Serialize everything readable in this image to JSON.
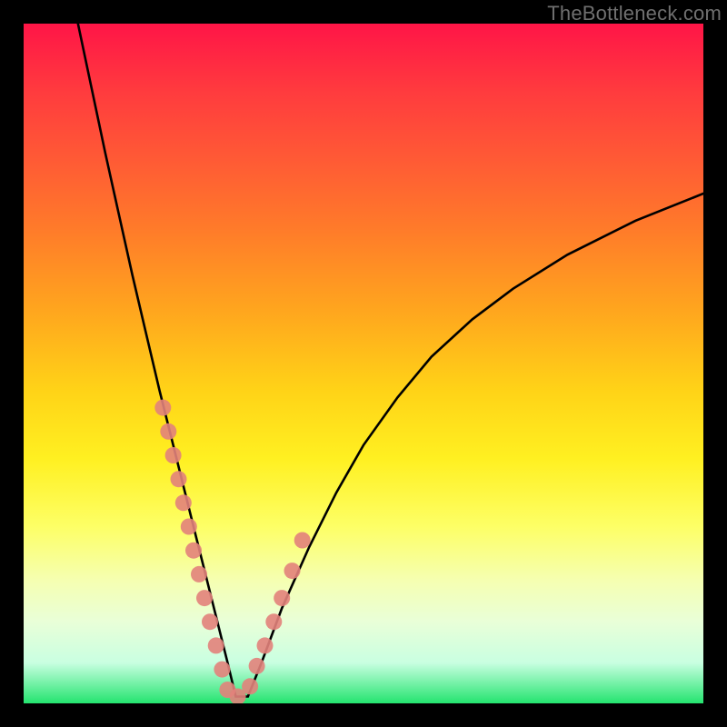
{
  "watermark": "TheBottleneck.com",
  "chart_data": {
    "type": "line",
    "title": "",
    "xlabel": "",
    "ylabel": "",
    "xlim": [
      0,
      100
    ],
    "ylim": [
      0,
      100
    ],
    "series": [
      {
        "name": "bottleneck-curve",
        "x": [
          8,
          10,
          12,
          14,
          16,
          18,
          20,
          22,
          24,
          25.5,
          27,
          28.5,
          30,
          31.2,
          33,
          35,
          38,
          42,
          46,
          50,
          55,
          60,
          66,
          72,
          80,
          90,
          100
        ],
        "y": [
          100,
          90.5,
          81,
          72,
          63,
          54.5,
          46,
          38,
          30,
          24,
          18,
          12,
          6,
          1,
          1,
          6,
          14,
          23,
          31,
          38,
          45,
          51,
          56.5,
          61,
          66,
          71,
          75
        ]
      }
    ],
    "points": {
      "name": "sample-dots",
      "x": [
        20.5,
        21.3,
        22.0,
        22.8,
        23.5,
        24.3,
        25.0,
        25.8,
        26.6,
        27.4,
        28.3,
        29.2,
        30.0,
        31.5,
        33.3,
        34.3,
        35.5,
        36.8,
        38.0,
        39.5,
        41.0
      ],
      "y": [
        43.5,
        40.0,
        36.5,
        33.0,
        29.5,
        26.0,
        22.5,
        19.0,
        15.5,
        12.0,
        8.5,
        5.0,
        2.0,
        1.0,
        2.5,
        5.5,
        8.5,
        12.0,
        15.5,
        19.5,
        24.0
      ]
    },
    "background_gradient": {
      "top": "#ff1547",
      "mid": "#fff021",
      "bottom": "#24e46f"
    }
  }
}
